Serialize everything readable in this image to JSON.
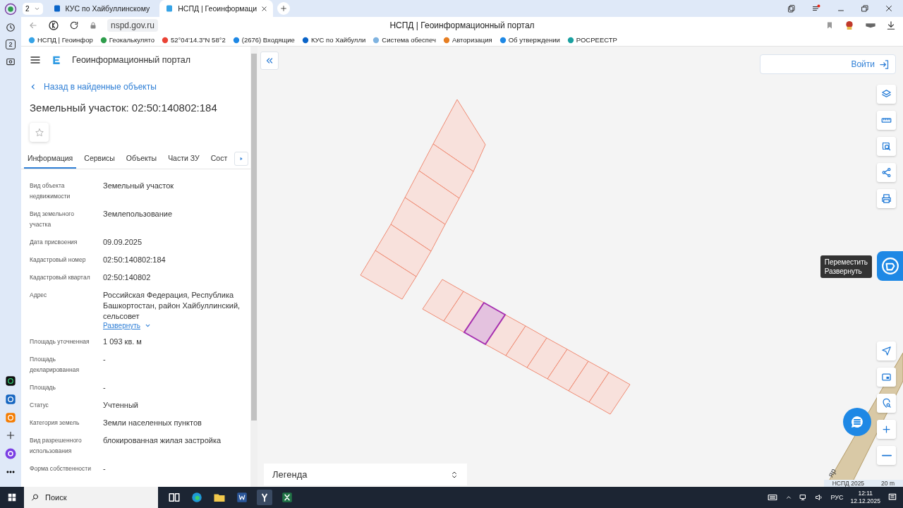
{
  "browser": {
    "tab_counter": "2",
    "tabs": [
      {
        "title": "КУС по Хайбуллинскому",
        "selected": false
      },
      {
        "title": "НСПД | Геоинформаци",
        "selected": true
      }
    ],
    "address": "nspd.gov.ru",
    "page_title": "НСПД | Геоинформационный портал",
    "bookmarks": [
      "НСПД | Геоинфор",
      "Геокалькулято",
      "52°04'14.3\"N 58°2",
      "(2676) Входящие",
      "КУС по Хайбулли",
      "Система обеспеч",
      "Авторизация",
      "Об утверждении",
      "РОСРЕЕСТР"
    ],
    "sidebar_counter": "2"
  },
  "panel": {
    "portal_name": "Геоинформационный портал",
    "back_link": "Назад в найденные объекты",
    "title": "Земельный участок: 02:50:140802:184",
    "tabs": [
      {
        "label": "Информация",
        "selected": true
      },
      {
        "label": "Сервисы",
        "selected": false
      },
      {
        "label": "Объекты",
        "selected": false
      },
      {
        "label": "Части ЗУ",
        "selected": false
      },
      {
        "label": "Сост",
        "selected": false
      }
    ],
    "fields": [
      {
        "label": "Вид объекта недвижимости",
        "value": "Земельный участок"
      },
      {
        "label": "Вид земельного участка",
        "value": "Землепользование"
      },
      {
        "label": "Дата присвоения",
        "value": "09.09.2025"
      },
      {
        "label": "Кадастровый номер",
        "value": "02:50:140802:184"
      },
      {
        "label": "Кадастровый квартал",
        "value": "02:50:140802"
      },
      {
        "label": "Адрес",
        "value": "Российская Федерация, Республика Башкортостан, район Хайбуллинский, сельсовет",
        "expand_link": "Развернуть"
      },
      {
        "label": "Площадь уточненная",
        "value": "1 093 кв. м"
      },
      {
        "label": "Площадь декларированная",
        "value": "-"
      },
      {
        "label": "Площадь",
        "value": "-"
      },
      {
        "label": "Статус",
        "value": "Учтенный"
      },
      {
        "label": "Категория земель",
        "value": "Земли населенных пунктов"
      },
      {
        "label": "Вид разрешенного использования",
        "value": "блокированная жилая застройка"
      },
      {
        "label": "Форма собственности",
        "value": "-"
      }
    ]
  },
  "map": {
    "login": "Войти",
    "legend": "Легенда",
    "tooltip": [
      "Переместить",
      "Развернуть"
    ],
    "road_label": "яр",
    "attribution": "НСПД 2025",
    "scale": "20 m",
    "parcels": [
      {
        "selected": false
      },
      {
        "selected": false
      },
      {
        "selected": false
      },
      {
        "selected": false
      },
      {
        "selected": false
      },
      {
        "selected": false
      },
      {
        "selected": false
      },
      {
        "selected": false
      },
      {
        "selected": true
      },
      {
        "selected": false
      },
      {
        "selected": false
      },
      {
        "selected": false
      },
      {
        "selected": false
      },
      {
        "selected": false
      },
      {
        "selected": false
      }
    ]
  },
  "taskbar": {
    "search": "Поиск",
    "language": "РУС",
    "time": "12:11",
    "date": "12.12.2025"
  }
}
